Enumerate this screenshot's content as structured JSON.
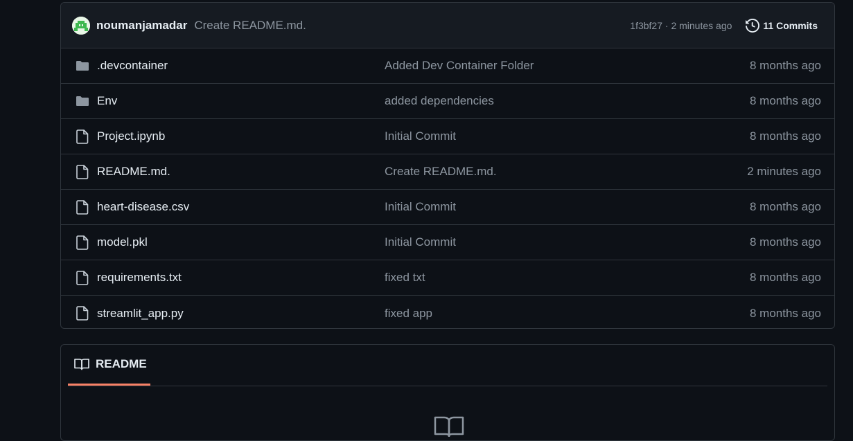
{
  "latest_commit": {
    "author": "noumanjamadar",
    "message": "Create README.md.",
    "meta": "1f3bf27 · 2 minutes ago",
    "commits_label": "11 Commits",
    "commits_icon": "history-icon"
  },
  "files": [
    {
      "name": ".devcontainer",
      "type": "folder",
      "icon": "folder-icon",
      "message": "Added Dev Container Folder",
      "date": "8 months ago"
    },
    {
      "name": "Env",
      "type": "folder",
      "icon": "folder-icon",
      "message": "added dependencies",
      "date": "8 months ago"
    },
    {
      "name": "Project.ipynb",
      "type": "file",
      "icon": "file-icon",
      "message": "Initial Commit",
      "date": "8 months ago"
    },
    {
      "name": "README.md.",
      "type": "file",
      "icon": "file-icon",
      "message": "Create README.md.",
      "date": "2 minutes ago"
    },
    {
      "name": "heart-disease.csv",
      "type": "file",
      "icon": "file-icon",
      "message": "Initial Commit",
      "date": "8 months ago"
    },
    {
      "name": "model.pkl",
      "type": "file",
      "icon": "file-icon",
      "message": "Initial Commit",
      "date": "8 months ago"
    },
    {
      "name": "requirements.txt",
      "type": "file",
      "icon": "file-icon",
      "message": "fixed txt",
      "date": "8 months ago"
    },
    {
      "name": "streamlit_app.py",
      "type": "file",
      "icon": "file-icon",
      "message": "fixed app",
      "date": "8 months ago"
    }
  ],
  "readme": {
    "tab_label": "README",
    "tab_icon": "book-icon"
  },
  "colors": {
    "background": "#0d1117",
    "border": "#30363d",
    "muted_text": "#8d96a0",
    "text": "#e6edf3",
    "tab_underline": "#f78166",
    "folder": "#8d96a0"
  }
}
